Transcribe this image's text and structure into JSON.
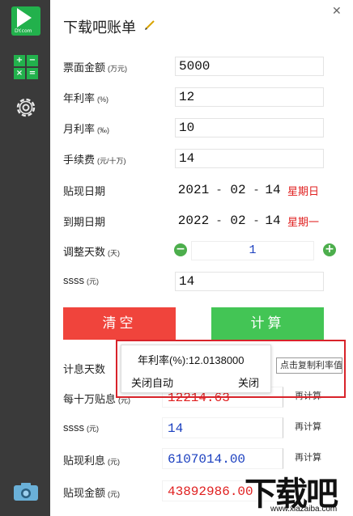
{
  "app": {
    "logo_text": "DY.com",
    "title": "下载吧账单"
  },
  "inputs": {
    "face_amount": {
      "label": "票面金额",
      "unit": "(万元)",
      "value": "5000"
    },
    "annual_rate": {
      "label": "年利率",
      "unit": "(%)",
      "value": "12"
    },
    "monthly_rate": {
      "label": "月利率",
      "unit": "(‰)",
      "value": "10"
    },
    "fee": {
      "label": "手续费",
      "unit": "(元/十万)",
      "value": "14"
    },
    "discount_date": {
      "label": "贴现日期",
      "year": "2021",
      "month": "02",
      "day": "14",
      "weekday": "星期日"
    },
    "due_date": {
      "label": "到期日期",
      "year": "2022",
      "month": "02",
      "day": "14",
      "weekday": "星期一"
    },
    "adjust_days": {
      "label": "调整天数",
      "unit": "(天)",
      "value": "1",
      "minus": "−",
      "plus": "+"
    },
    "ssss": {
      "label": "ssss",
      "unit": "(元)",
      "value": "14"
    }
  },
  "actions": {
    "clear_label": "清空",
    "calc_label": "计算"
  },
  "results": {
    "interest_days": {
      "label": "计息天数"
    },
    "per_100k": {
      "label": "每十万贴息",
      "unit": "(元)",
      "value": "12214.63",
      "recalc": "再计算"
    },
    "ssss": {
      "label": "ssss",
      "unit": "(元)",
      "value": "14",
      "recalc": "再计算"
    },
    "discount_interest": {
      "label": "贴现利息",
      "unit": "(元)",
      "value": "6107014.00",
      "recalc": "再计算"
    },
    "discount_amount": {
      "label": "贴现金额",
      "unit": "(元)",
      "value": "43892986.00"
    }
  },
  "popup": {
    "rate_text": "年利率(%):12.0138000",
    "auto_close": "关闭自动",
    "close": "关闭",
    "tooltip": "点击复制利率值。"
  },
  "watermark": {
    "text": "下载吧",
    "url": "www.xiazaiba.com"
  },
  "colors": {
    "sidebar": "#3a3a3a",
    "accent_green": "#43c555",
    "clear_red": "#f0443c",
    "weekday_red": "#e02020",
    "value_blue": "#1a3fbf"
  }
}
